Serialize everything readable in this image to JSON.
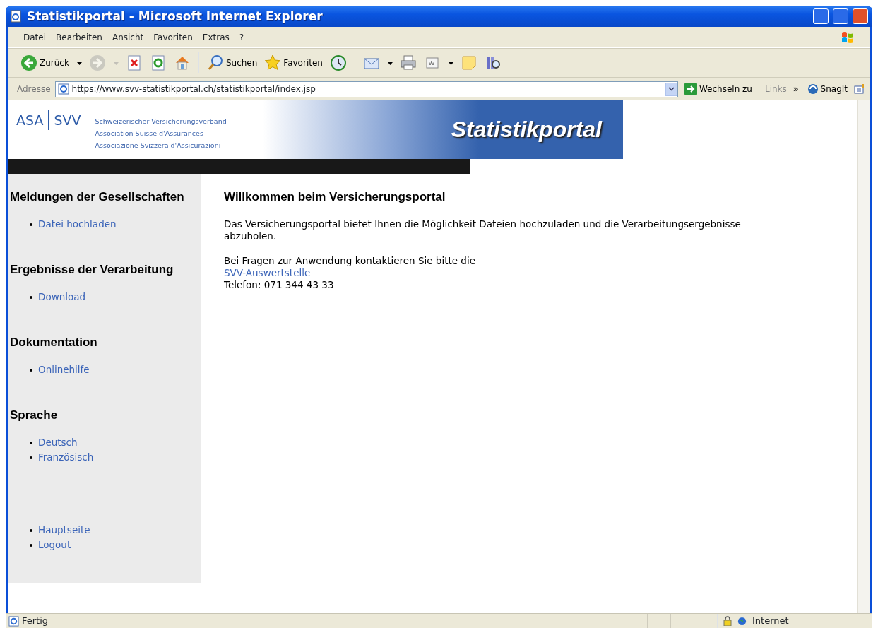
{
  "window": {
    "title": "Statistikportal - Microsoft Internet Explorer"
  },
  "menu_bar": [
    "Datei",
    "Bearbeiten",
    "Ansicht",
    "Favoriten",
    "Extras",
    "?"
  ],
  "toolbar": [
    {
      "kind": "back",
      "label": "Zurück",
      "dropdown": true,
      "disabled": false
    },
    {
      "kind": "forward",
      "dropdown": true,
      "disabled": true
    },
    {
      "kind": "stop",
      "dropdown": false,
      "disabled": false
    },
    {
      "kind": "refresh",
      "dropdown": false,
      "disabled": false
    },
    {
      "kind": "home",
      "dropdown": false,
      "disabled": false
    },
    {
      "kind": "search",
      "label": "Suchen",
      "dropdown": false,
      "disabled": false
    },
    {
      "kind": "favorites",
      "label": "Favoriten",
      "dropdown": false,
      "disabled": false
    },
    {
      "kind": "history",
      "dropdown": false,
      "disabled": false
    },
    {
      "kind": "mail",
      "dropdown": true,
      "disabled": false
    },
    {
      "kind": "print",
      "dropdown": false,
      "disabled": false
    },
    {
      "kind": "edit",
      "dropdown": true,
      "disabled": false
    },
    {
      "kind": "notes",
      "dropdown": false,
      "disabled": false
    },
    {
      "kind": "research",
      "dropdown": false,
      "disabled": false
    }
  ],
  "address_bar": {
    "label": "Adresse",
    "url": "https://www.svv-statistikportal.ch/statistikportal/index.jsp",
    "go": "Wechseln zu",
    "links": "Links",
    "chevron": "»",
    "extension": "SnagIt"
  },
  "banner": {
    "logo_left": "ASA",
    "logo_right": "SVV",
    "names": [
      "Schweizerischer Versicherungsverband",
      "Association Suisse d'Assurances",
      "Associazione Svizzera d'Assicurazioni"
    ],
    "title": "Statistikportal"
  },
  "sidebar": {
    "sections": [
      {
        "heading": "Meldungen der Gesellschaften",
        "links": [
          "Datei hochladen"
        ]
      },
      {
        "heading": "Ergebnisse der Verarbeitung",
        "links": [
          "Download"
        ]
      },
      {
        "heading": "Dokumentation",
        "links": [
          "Onlinehilfe"
        ]
      },
      {
        "heading": "Sprache",
        "links": [
          "Deutsch",
          "Französisch"
        ]
      }
    ],
    "bottom_links": [
      "Hauptseite",
      "Logout"
    ]
  },
  "main": {
    "heading": "Willkommen beim Versicherungsportal",
    "intro": "Das Versicherungsportal bietet Ihnen die Möglichkeit Dateien hochzuladen und die Verarbeitungsergebnisse abzuholen.",
    "contact_text": "Bei Fragen zur Anwendung kontaktieren Sie bitte die",
    "contact_link": "SVV-Auswertstelle",
    "phone": "Telefon: 071 344 43 33"
  },
  "status_bar": {
    "text": "Fertig",
    "zone": "Internet"
  }
}
